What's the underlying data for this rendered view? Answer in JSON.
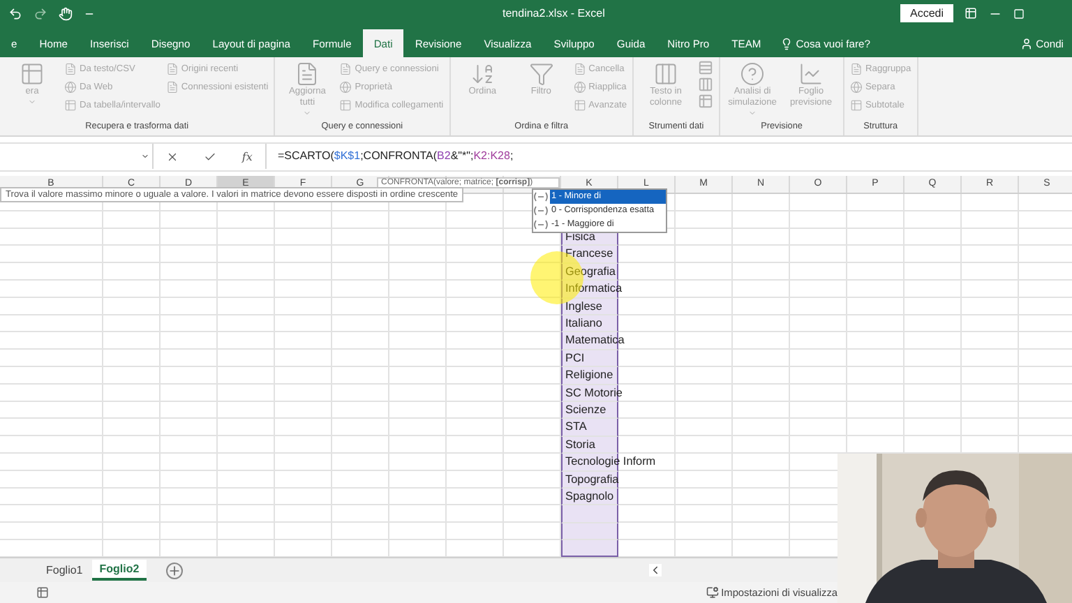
{
  "title_bar": {
    "title": "tendina2.xlsx - Excel",
    "signin": "Accedi"
  },
  "tabs": [
    {
      "label": "e",
      "selected": false
    },
    {
      "label": "Home",
      "selected": false
    },
    {
      "label": "Inserisci",
      "selected": false
    },
    {
      "label": "Disegno",
      "selected": false
    },
    {
      "label": "Layout di pagina",
      "selected": false
    },
    {
      "label": "Formule",
      "selected": false
    },
    {
      "label": "Dati",
      "selected": true
    },
    {
      "label": "Revisione",
      "selected": false
    },
    {
      "label": "Visualizza",
      "selected": false
    },
    {
      "label": "Sviluppo",
      "selected": false
    },
    {
      "label": "Guida",
      "selected": false
    },
    {
      "label": "Nitro Pro",
      "selected": false
    },
    {
      "label": "TEAM",
      "selected": false
    }
  ],
  "tell_me": "Cosa vuoi fare?",
  "share": "Condi",
  "ribbon": {
    "disabled": true,
    "groups": [
      {
        "label": "Recupera e trasforma dati",
        "large": [
          {
            "label": "era",
            "dropdown": true
          }
        ],
        "small": [
          {
            "label": "Da testo/CSV"
          },
          {
            "label": "Da Web"
          },
          {
            "label": "Da tabella/intervallo"
          },
          {
            "label": "Origini recenti"
          },
          {
            "label": "Connessioni esistenti"
          }
        ]
      },
      {
        "label": "Query e connessioni",
        "large": [
          {
            "label": "Aggiorna tutti",
            "dropdown": true
          }
        ],
        "small": [
          {
            "label": "Query e connessioni"
          },
          {
            "label": "Proprietà"
          },
          {
            "label": "Modifica collegamenti"
          }
        ]
      },
      {
        "label": "Ordina e filtra",
        "large": [
          {
            "label": "Ordina",
            "dropdown": false
          },
          {
            "label": "Filtro",
            "dropdown": false
          }
        ],
        "small": [
          {
            "label": "Cancella"
          },
          {
            "label": "Riapplica"
          },
          {
            "label": "Avanzate"
          }
        ]
      },
      {
        "label": "Strumenti dati",
        "large": [
          {
            "label": "Testo in colonne",
            "dropdown": false
          }
        ]
      },
      {
        "label": "Previsione",
        "large": [
          {
            "label": "Analisi di simulazione",
            "dropdown": true
          },
          {
            "label": "Foglio previsione",
            "dropdown": false
          }
        ]
      },
      {
        "label": "Struttura",
        "small": [
          {
            "label": "Raggruppa"
          },
          {
            "label": "Separa"
          },
          {
            "label": "Subtotale"
          }
        ]
      }
    ]
  },
  "function_button": "fx",
  "formula": [
    {
      "text": "=SCARTO("
    },
    {
      "text": "$K$1",
      "color": "#2f6fd6"
    },
    {
      "text": ";CONFRONTA("
    },
    {
      "text": "B2",
      "color": "#8e3fb0"
    },
    {
      "text": "&\"*\";"
    },
    {
      "text": "K2:K28",
      "color": "#a03c9c"
    },
    {
      "text": ";"
    }
  ],
  "function_hint": "CONFRONTA(valore; matrice; **[corrisp]**)",
  "tooltip": "Trova il valore massimo minore o uguale a valore. I valori in matrice devono essere disposti in ordine crescente",
  "autocomplete": [
    {
      "label": "1 - Minore di",
      "selected": true
    },
    {
      "label": "0 - Corrispondenza esatta",
      "selected": false
    },
    {
      "label": "-1 - Maggiore di",
      "selected": false
    }
  ],
  "columns": [
    {
      "label": "B",
      "selected": false
    },
    {
      "label": "C",
      "selected": false
    },
    {
      "label": "D",
      "selected": false
    },
    {
      "label": "E",
      "selected": true
    },
    {
      "label": "F",
      "selected": false
    },
    {
      "label": "G",
      "selected": false
    },
    {
      "selected": false
    },
    {
      "selected": false
    },
    {
      "selected": false
    },
    {
      "label": "K",
      "selected": false
    },
    {
      "label": "L",
      "selected": false
    },
    {
      "label": "M",
      "selected": false
    },
    {
      "label": "N",
      "selected": false
    },
    {
      "label": "O",
      "selected": false
    },
    {
      "label": "P",
      "selected": false
    },
    {
      "label": "Q",
      "selected": false
    },
    {
      "label": "R",
      "selected": false
    },
    {
      "label": "S",
      "selected": false
    }
  ],
  "k_cells": [
    {
      "text": "Fisica",
      "selected": true
    },
    {
      "text": "Francese",
      "selected": true
    },
    {
      "text": "Geografia",
      "selected": true
    },
    {
      "text": "Informatica",
      "selected": true
    },
    {
      "text": "Inglese",
      "selected": true
    },
    {
      "text": "Italiano",
      "selected": true
    },
    {
      "text": "Matematica",
      "selected": true
    },
    {
      "text": "PCI",
      "selected": true
    },
    {
      "text": "Religione",
      "selected": true
    },
    {
      "text": "SC Motorie",
      "selected": true
    },
    {
      "text": "Scienze",
      "selected": true
    },
    {
      "text": "STA",
      "selected": true
    },
    {
      "text": "Storia",
      "selected": true
    },
    {
      "text": "Tecnologie Inform",
      "selected": true
    },
    {
      "text": "Topografia",
      "selected": true
    },
    {
      "text": "Spagnolo",
      "selected": true
    },
    {
      "selected": true
    },
    {
      "selected": true
    },
    {
      "selected": true
    }
  ],
  "sheets": [
    {
      "label": "Foglio1",
      "selected": false
    },
    {
      "label": "Foglio2",
      "selected": true
    }
  ],
  "status": "Impostazioni di visualizza"
}
